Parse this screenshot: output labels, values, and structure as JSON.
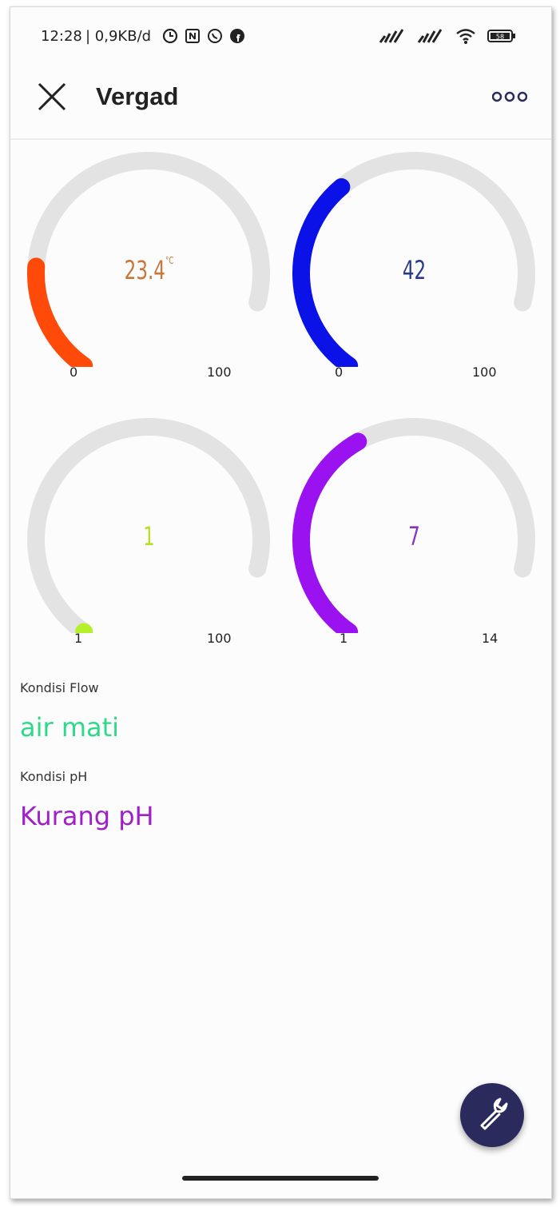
{
  "status_bar": {
    "time": "12:28",
    "speed": "| 0,9KB/d",
    "battery": "58"
  },
  "app_bar": {
    "title": "Vergad"
  },
  "gauges": [
    {
      "value": 23.4,
      "display": "23.4",
      "unit": "°C",
      "min": "0",
      "max": "100",
      "min_num": 0,
      "max_num": 100,
      "color": "#ff4a0a",
      "text_color": "#c8763a"
    },
    {
      "value": 42,
      "display": "42",
      "unit": "",
      "min": "0",
      "max": "100",
      "min_num": 0,
      "max_num": 100,
      "color": "#0a12e8",
      "text_color": "#2a3a8a"
    },
    {
      "value": 1,
      "display": "1",
      "unit": "",
      "min": "1",
      "max": "100",
      "min_num": 1,
      "max_num": 100,
      "color": "#b5f02a",
      "text_color": "#b5e02a"
    },
    {
      "value": 7,
      "display": "7",
      "unit": "",
      "min": "1",
      "max": "14",
      "min_num": 1,
      "max_num": 14,
      "color": "#9a12f0",
      "text_color": "#8a30c0"
    }
  ],
  "flow": {
    "label": "Kondisi Flow",
    "value": "air mati",
    "color": "#2fd98a"
  },
  "ph": {
    "label": "Kondisi pH",
    "value": "Kurang pH",
    "color": "#a020c8"
  },
  "colors": {
    "fab": "#2b2a5c",
    "track": "#e3e3e3"
  }
}
